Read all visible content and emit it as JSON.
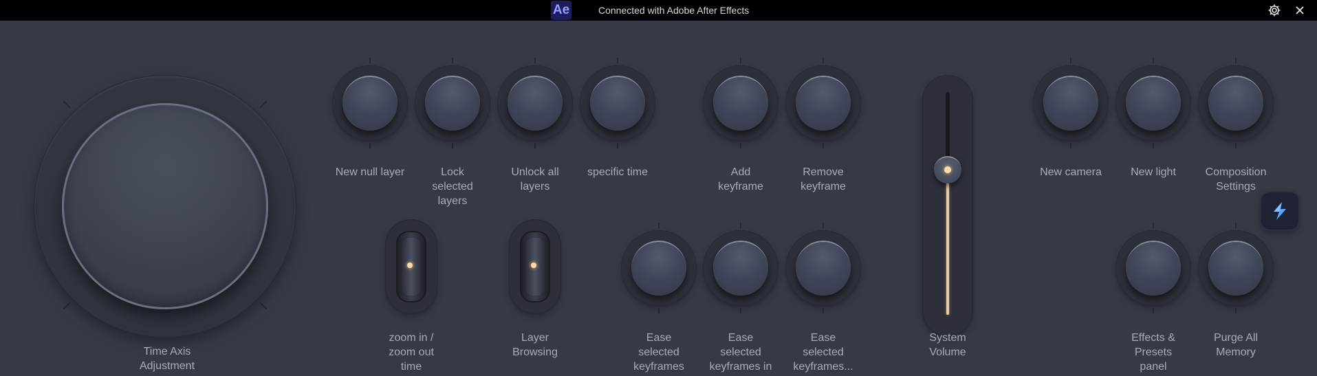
{
  "header": {
    "app_badge": "Ae",
    "title": "Connected with Adobe After Effects",
    "settings_icon": "gear-icon",
    "close_icon": "close-icon"
  },
  "dial": {
    "label": "Time Axis Adjustment"
  },
  "knobs": [
    {
      "label": "New null layer"
    },
    {
      "label": "Lock selected layers"
    },
    {
      "label": "Unlock all layers"
    },
    {
      "label": "specific time"
    },
    {
      "label": "Add keyframe"
    },
    {
      "label": "Remove keyframe"
    },
    {
      "label": "New camera"
    },
    {
      "label": "New light"
    },
    {
      "label": "Composition Settings"
    },
    {
      "label": "Ease selected keyframes"
    },
    {
      "label": "Ease selected keyframes in"
    },
    {
      "label": "Ease selected keyframes..."
    },
    {
      "label": "Effects & Presets panel"
    },
    {
      "label": "Purge All Memory"
    }
  ],
  "switches": [
    {
      "label": "zoom in / zoom out time"
    },
    {
      "label": "Layer Browsing"
    }
  ],
  "slider": {
    "label": "System Volume",
    "level": 0.65
  },
  "overlay": {
    "app_icon": "stream-deck-app-icon"
  },
  "colors": {
    "background": "#363a47",
    "topbar": "#000000",
    "accent_led": "#ffd9a8"
  }
}
